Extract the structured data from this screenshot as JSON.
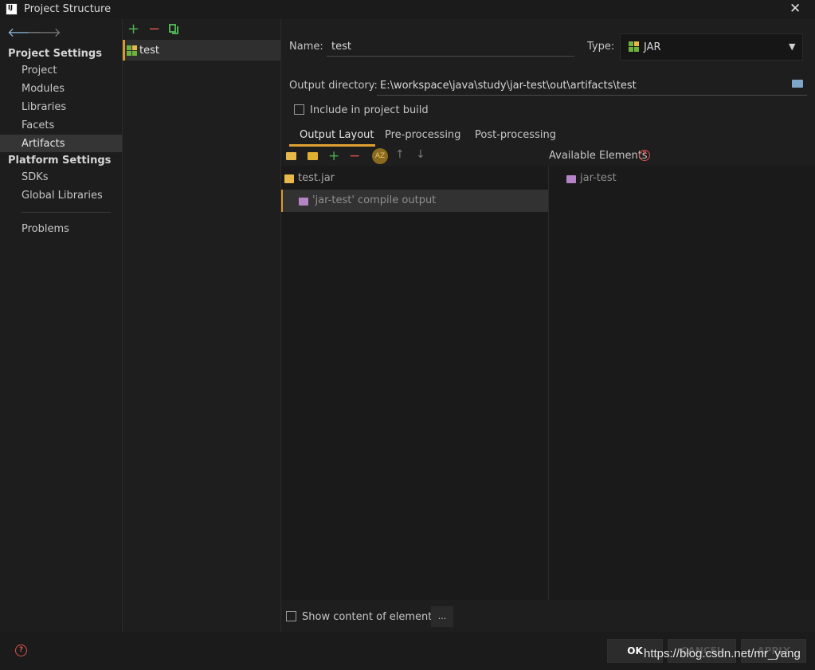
{
  "window": {
    "title": "Project Structure",
    "app_icon_text": "IJ"
  },
  "nav": {
    "back_icon": "arrow-left-icon",
    "forward_icon": "arrow-right-icon",
    "project_settings_header": "Project Settings",
    "project_settings_items": [
      "Project",
      "Modules",
      "Libraries",
      "Facets",
      "Artifacts"
    ],
    "platform_settings_header": "Platform Settings",
    "platform_settings_items": [
      "SDKs",
      "Global Libraries"
    ],
    "problems": "Problems",
    "selected": "Artifacts"
  },
  "artifacts": {
    "toolbar_icons": [
      "plus-icon",
      "minus-icon",
      "copy-icon"
    ],
    "items": [
      "test"
    ]
  },
  "editor": {
    "name_label": "Name:",
    "name_value": "test",
    "type_label": "Type:",
    "type_value": "JAR",
    "output_dir_label": "Output directory:",
    "output_dir_value": "E:\\workspace\\java\\study\\jar-test\\out\\artifacts\\test",
    "include_label": "Include in project build",
    "include_checked": false,
    "tabs": [
      "Output Layout",
      "Pre-processing",
      "Post-processing"
    ],
    "active_tab": "Output Layout"
  },
  "layout": {
    "tree": {
      "root": "test.jar",
      "child": "'jar-test' compile output"
    }
  },
  "available": {
    "label": "Available Elements",
    "items": [
      "jar-test"
    ]
  },
  "bottom": {
    "show_content_label": "Show content of elements",
    "show_content_checked": false,
    "ellipsis_button": "..."
  },
  "footer": {
    "ok": "OK",
    "cancel": "CANCEL",
    "apply": "APPLY",
    "watermark": "https://blog.csdn.net/mr_yang"
  },
  "colors": {
    "accent": "#d99b2d",
    "background": "#1e1e1e",
    "add_green": "#4caf50",
    "remove_red": "#d9534f"
  }
}
